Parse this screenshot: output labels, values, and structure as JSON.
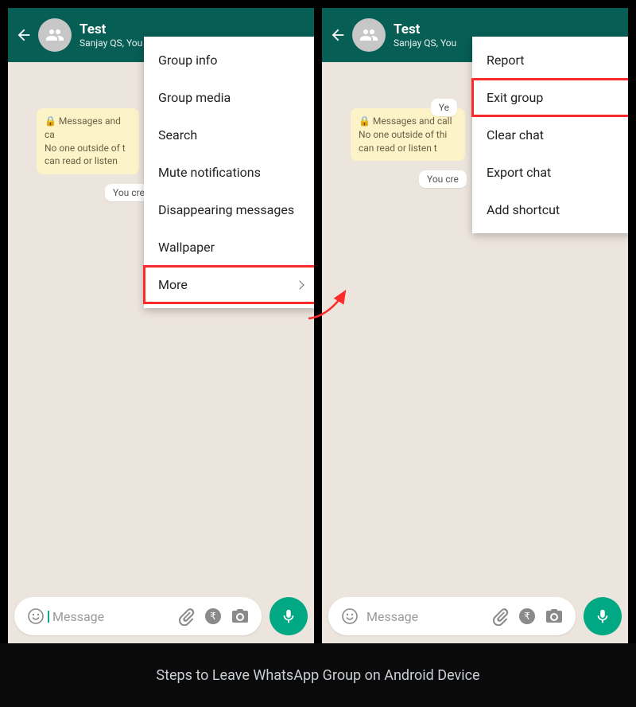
{
  "caption": "Steps to Leave WhatsApp Group on Android Device",
  "header": {
    "title": "Test",
    "subtitle": "Sanjay QS, You"
  },
  "chat": {
    "date_pill": "Yesterday",
    "encryption_notice_full": "🔒 Messages and calls are end-to-end encrypted. No one outside of this chat, not even WhatsApp, can read or listen to them. Tap to learn more.",
    "encryption_notice_left_visible": "🔒 Messages and ca\nNo one outside of t\ncan read or listen",
    "encryption_notice_right_visible": "🔒 Messages and call\nNo one outside of thi\ncan read or listen t",
    "created_full": "You created this group",
    "created_left_visible": "You cre",
    "created_right_visible": "You cre"
  },
  "menu_main": [
    {
      "label": "Group info"
    },
    {
      "label": "Group media"
    },
    {
      "label": "Search"
    },
    {
      "label": "Mute notifications"
    },
    {
      "label": "Disappearing messages"
    },
    {
      "label": "Wallpaper"
    },
    {
      "label": "More",
      "submenu": true,
      "highlight": true
    }
  ],
  "menu_sub": [
    {
      "label": "Report"
    },
    {
      "label": "Exit group",
      "highlight": true
    },
    {
      "label": "Clear chat"
    },
    {
      "label": "Export chat"
    },
    {
      "label": "Add shortcut"
    }
  ],
  "composer": {
    "placeholder": "Message"
  }
}
